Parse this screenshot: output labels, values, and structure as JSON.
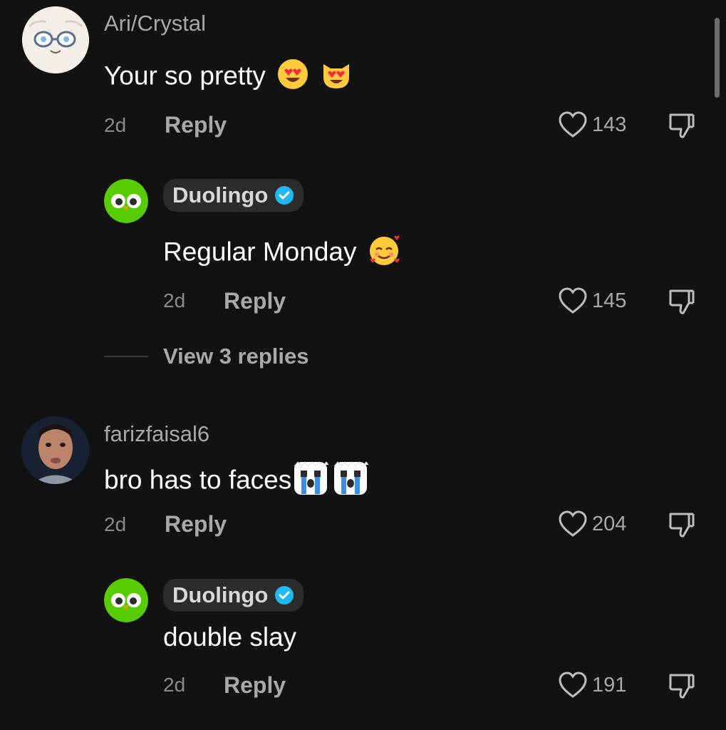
{
  "colors": {
    "background": "#121212",
    "secondary_text": "#a8a8a8",
    "verified_badge": "#20b8f0",
    "duolingo_green": "#58cc02"
  },
  "comments": [
    {
      "username": "Ari/Crystal",
      "text": "Your so pretty",
      "emojis": [
        "heart-eyes-face",
        "heart-eyes-cat"
      ],
      "time": "2d",
      "reply_label": "Reply",
      "likes": "143",
      "replies": [
        {
          "username": "Duolingo",
          "verified": true,
          "text": "Regular Monday",
          "emojis": [
            "smiling-face-with-hearts"
          ],
          "time": "2d",
          "reply_label": "Reply",
          "likes": "145"
        }
      ],
      "view_replies": "View 3 replies"
    },
    {
      "username": "farizfaisal6",
      "text": "bro has to faces",
      "emojis": [
        "crying-face-square",
        "crying-face-square"
      ],
      "time": "2d",
      "reply_label": "Reply",
      "likes": "204",
      "replies": [
        {
          "username": "Duolingo",
          "verified": true,
          "text": "double slay",
          "time": "2d",
          "reply_label": "Reply",
          "likes": "191"
        }
      ]
    }
  ]
}
